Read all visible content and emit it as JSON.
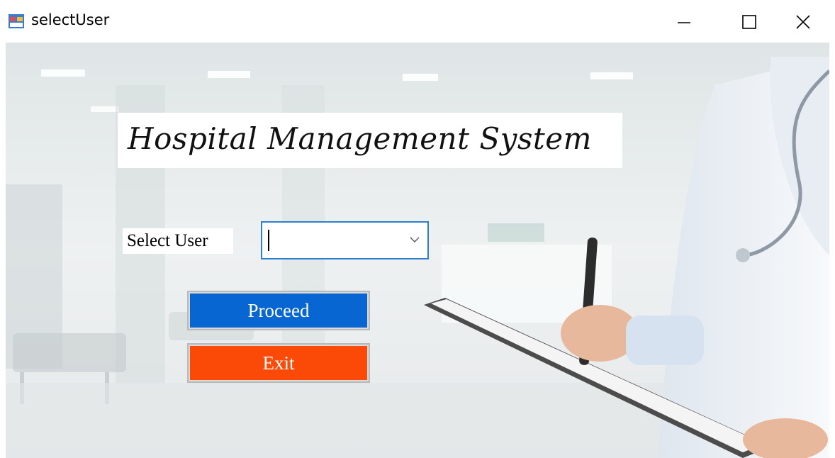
{
  "window": {
    "title": "selectUser",
    "icon": "form-icon",
    "controls": [
      "minimize-icon",
      "maximize-icon",
      "close-icon"
    ]
  },
  "form": {
    "heading": "Hospital Management System",
    "select_label": "Select User",
    "select_value": "",
    "proceed_label": "Proceed",
    "exit_label": "Exit"
  },
  "colors": {
    "proceed": "#0866d2",
    "exit": "#fb4a07",
    "select_border": "#2f7fd1"
  }
}
